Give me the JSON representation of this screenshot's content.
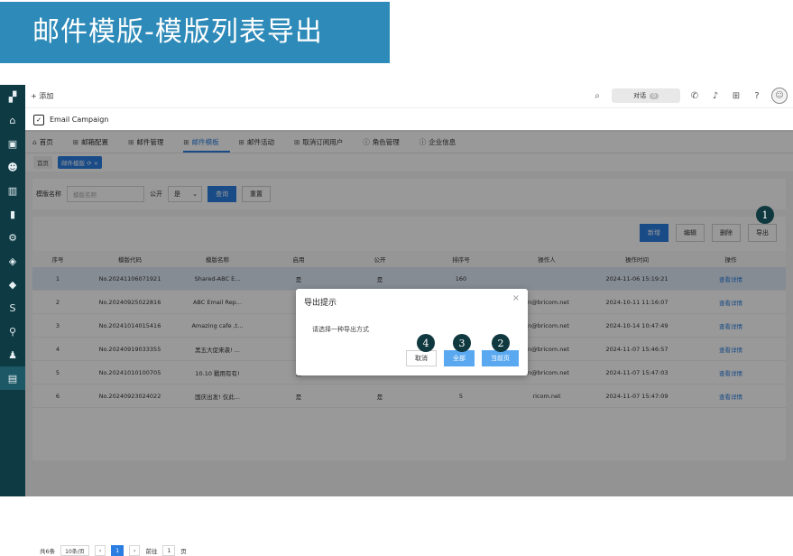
{
  "banner": {
    "title": "邮件模版-模版列表导出"
  },
  "topbar": {
    "add_label": "+ 添加",
    "dialog_label": "对话",
    "dialog_count": "0"
  },
  "campaign": {
    "title": "Email Campaign"
  },
  "tabs": [
    {
      "label": "首页",
      "icon": "home-icon"
    },
    {
      "label": "邮箱配置",
      "icon": "grid-icon"
    },
    {
      "label": "邮件管理",
      "icon": "grid-icon"
    },
    {
      "label": "邮件模板",
      "icon": "grid-icon",
      "active": true
    },
    {
      "label": "邮件活动",
      "icon": "grid-icon"
    },
    {
      "label": "取消订阅用户",
      "icon": "grid-icon"
    },
    {
      "label": "角色管理",
      "icon": "info-icon"
    },
    {
      "label": "企业信息",
      "icon": "info-icon"
    }
  ],
  "crumbs": {
    "home": "首页",
    "active": "邮件模版"
  },
  "filter": {
    "name_label": "模版名称",
    "name_placeholder": "模版名称",
    "public_label": "公开",
    "public_value": "是",
    "query": "查询",
    "reset": "重置"
  },
  "actions": {
    "add": "新增",
    "edit": "编辑",
    "delete": "删除",
    "export": "导出"
  },
  "table": {
    "headers": [
      "序号",
      "模版代码",
      "模版名称",
      "启用",
      "公开",
      "排序号",
      "操作人",
      "操作时间",
      "操作"
    ],
    "rows": [
      [
        "1",
        "No.20241106071921",
        "Shared-ABC E...",
        "是",
        "是",
        "160",
        "",
        "2024-11-06 15:19:21",
        "查看详情"
      ],
      [
        "2",
        "No.20240925022816",
        "ABC Email Rep...",
        "是",
        "",
        "",
        "an@bricom.net",
        "2024-10-11 11:16:07",
        "查看详情"
      ],
      [
        "3",
        "No.20241014015416",
        "Amazing cafe ,t...",
        "否",
        "",
        "",
        "an@bricom.net",
        "2024-10-14 10:47:49",
        "查看详情"
      ],
      [
        "4",
        "No.20240919033355",
        "黑五大促来袭! ...",
        "是",
        "",
        "",
        "an@bricom.net",
        "2024-11-07 15:46:57",
        "查看详情"
      ],
      [
        "5",
        "No.20241010100705",
        "10.10 戳用有有!",
        "是",
        "",
        "",
        "an@bricom.net",
        "2024-11-07 15:47:03",
        "查看详情"
      ],
      [
        "6",
        "No.20240923024022",
        "国庆出发! 仅此...",
        "是",
        "是",
        "5",
        "ricom.net",
        "2024-11-07 15:47:09",
        "查看详情"
      ]
    ]
  },
  "pager": {
    "total": "共6条",
    "size": "10条/页",
    "page": "1",
    "goto": "前往",
    "goto_value": "1",
    "unit": "页"
  },
  "modal": {
    "title": "导出提示",
    "close": "×",
    "body": "请选择一种导出方式",
    "cancel": "取消",
    "all": "全部",
    "current": "当前页"
  },
  "markers": [
    "1",
    "2",
    "3",
    "4"
  ]
}
